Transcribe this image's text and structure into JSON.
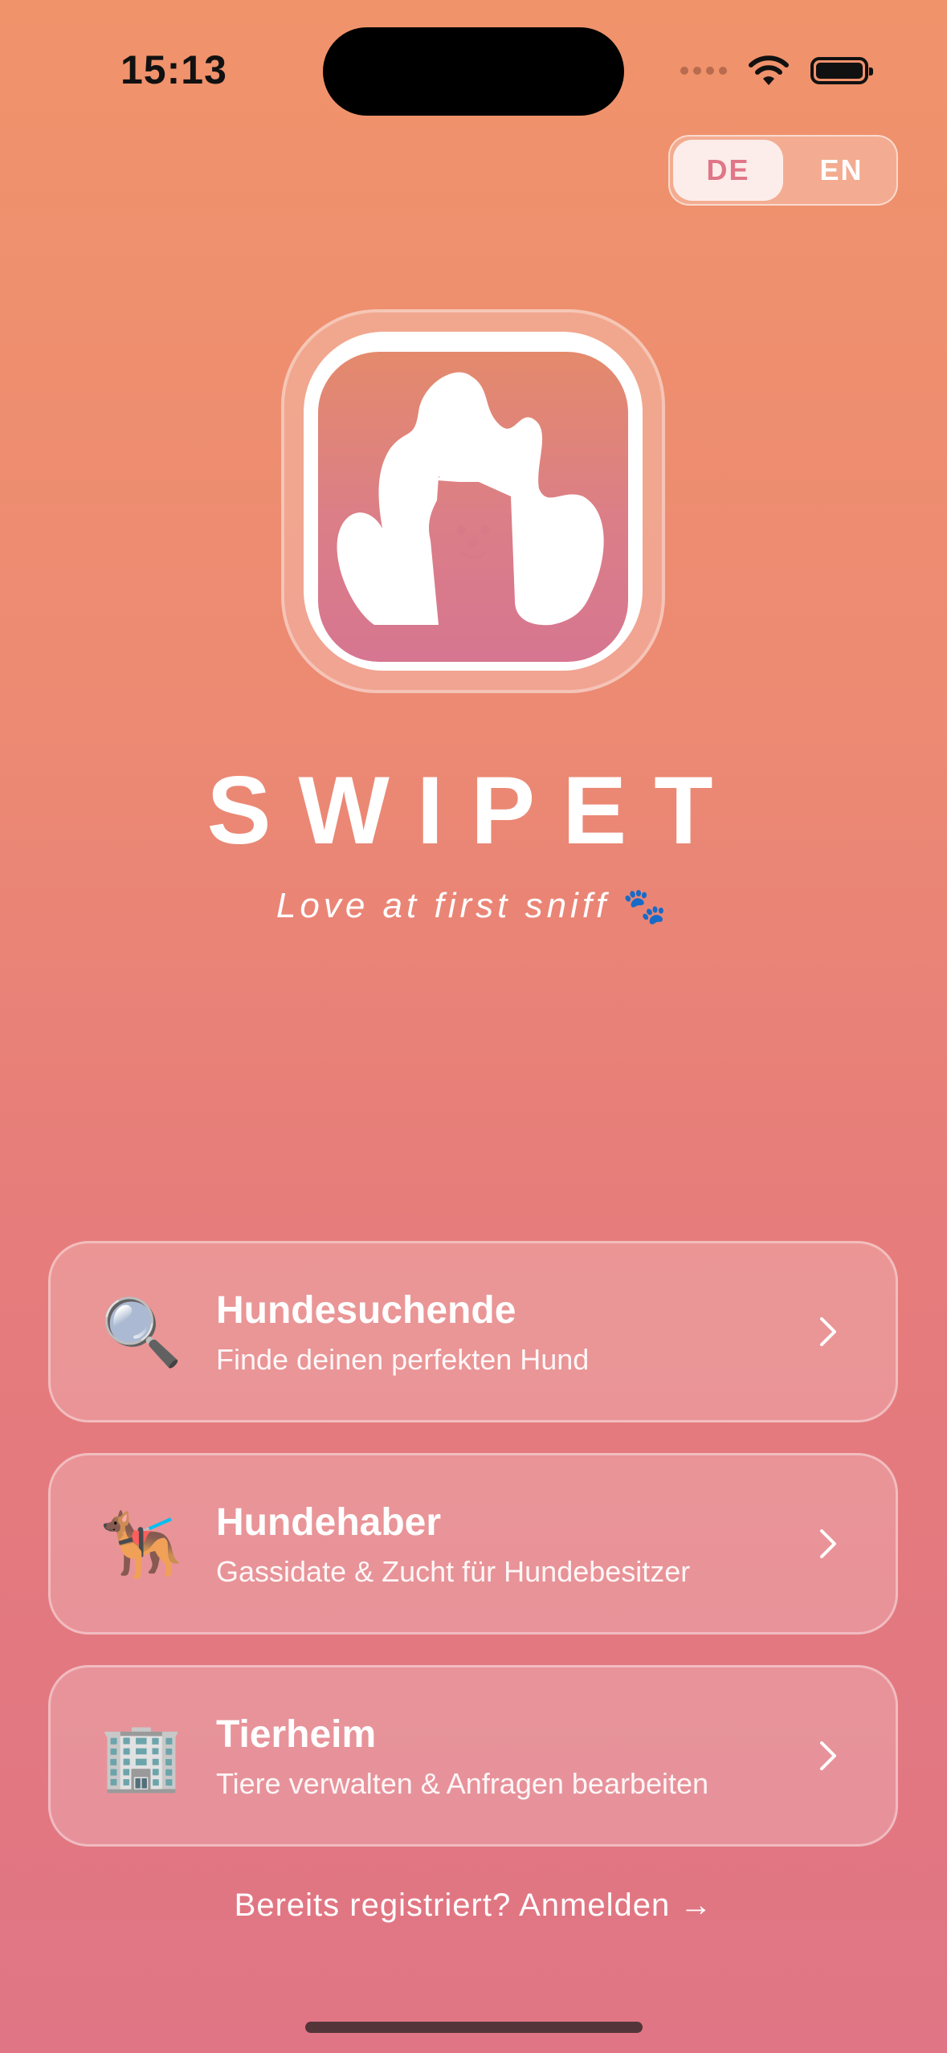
{
  "status_bar": {
    "time": "15:13"
  },
  "language_toggle": {
    "active": "DE",
    "inactive": "EN"
  },
  "brand": {
    "name": "SWIPET",
    "tagline": "Love at first sniff",
    "tagline_icon": "🐾"
  },
  "roles": [
    {
      "icon": "🔍",
      "icon_name": "magnifier-icon",
      "title": "Hundesuchende",
      "subtitle": "Finde deinen perfekten Hund"
    },
    {
      "icon": "🐕‍🦺",
      "icon_name": "guide-dog-icon",
      "title": "Hundehaber",
      "subtitle": "Gassidate & Zucht für Hundebesitzer"
    },
    {
      "icon": "🏢",
      "icon_name": "office-building-icon",
      "title": "Tierheim",
      "subtitle": "Tiere verwalten & Anfragen bearbeiten"
    }
  ],
  "signin_link": "Bereits registriert? Anmelden →",
  "colors": {
    "accent": "#E07687",
    "gradient_top": "#F0936B",
    "gradient_bottom": "#E07585"
  }
}
